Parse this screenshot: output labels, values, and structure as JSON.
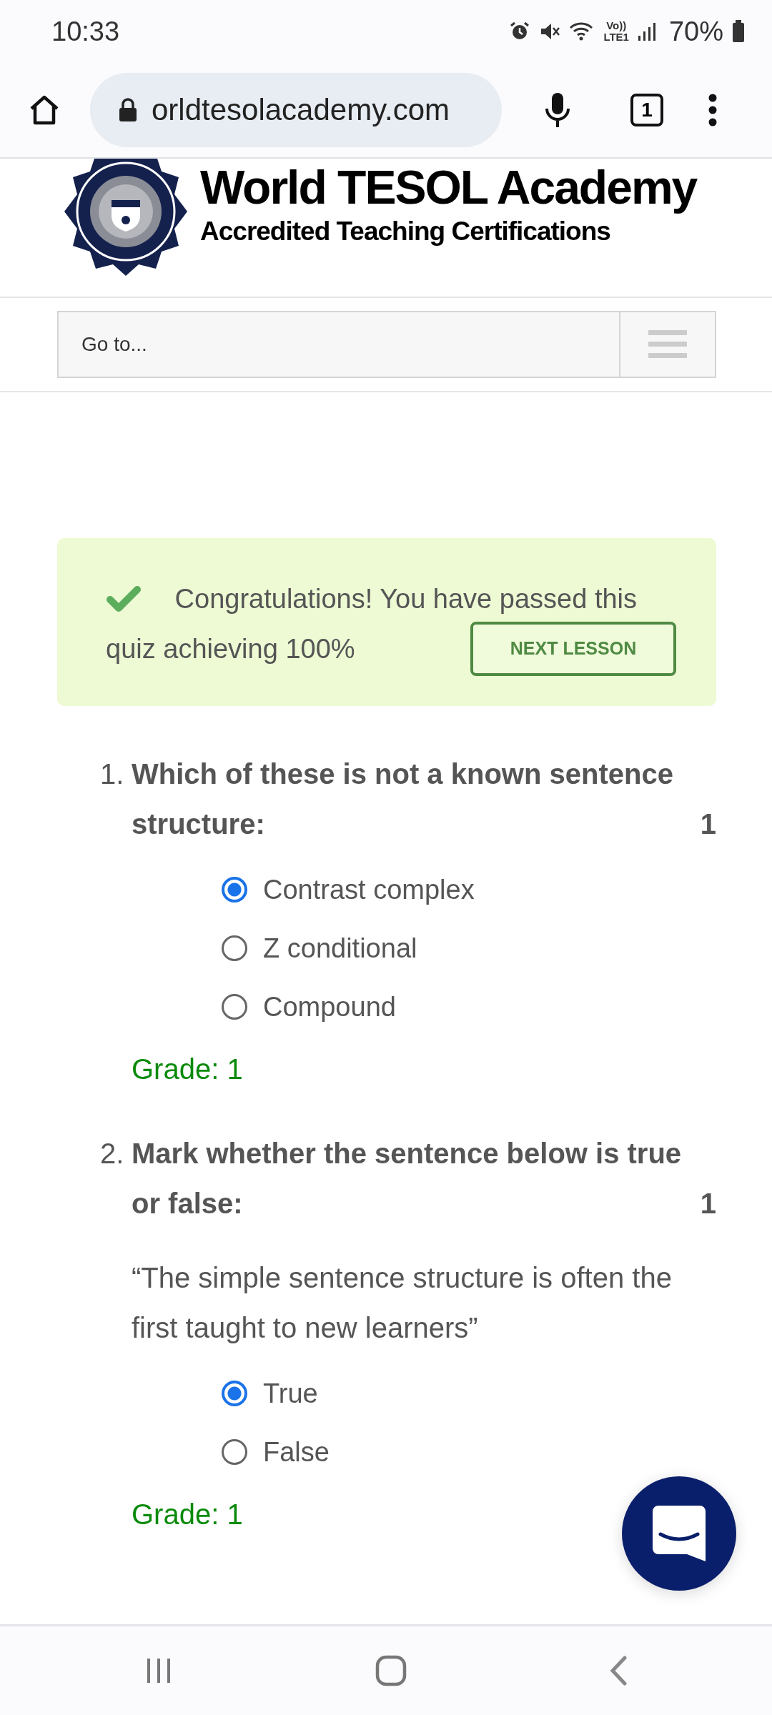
{
  "status_bar": {
    "time": "10:33",
    "network_label": [
      "Vo))",
      "LTE1"
    ],
    "battery": "70%"
  },
  "browser": {
    "url": "orldtesolacademy.com",
    "tab_count": "1"
  },
  "site": {
    "title": "World TESOL Academy",
    "subtitle": "Accredited Teaching Certifications",
    "nav_select": "Go to..."
  },
  "banner": {
    "message_lines": [
      "Congratulations! You have passed this",
      "quiz achieving 100%"
    ],
    "button": "NEXT LESSON"
  },
  "questions": [
    {
      "number": "1.",
      "text": "Which of these is not a known sentence structure:",
      "points": "1",
      "options": [
        {
          "label": "Contrast complex",
          "selected": true
        },
        {
          "label": "Z conditional",
          "selected": false
        },
        {
          "label": "Compound",
          "selected": false
        }
      ],
      "grade": "Grade: 1"
    },
    {
      "number": "2.",
      "text": "Mark whether the sentence below is true or false:",
      "points": "1",
      "quote": "“The simple sentence structure is often the first taught to new learners”",
      "options": [
        {
          "label": "True",
          "selected": true
        },
        {
          "label": "False",
          "selected": false
        }
      ],
      "grade": "Grade: 1"
    }
  ]
}
